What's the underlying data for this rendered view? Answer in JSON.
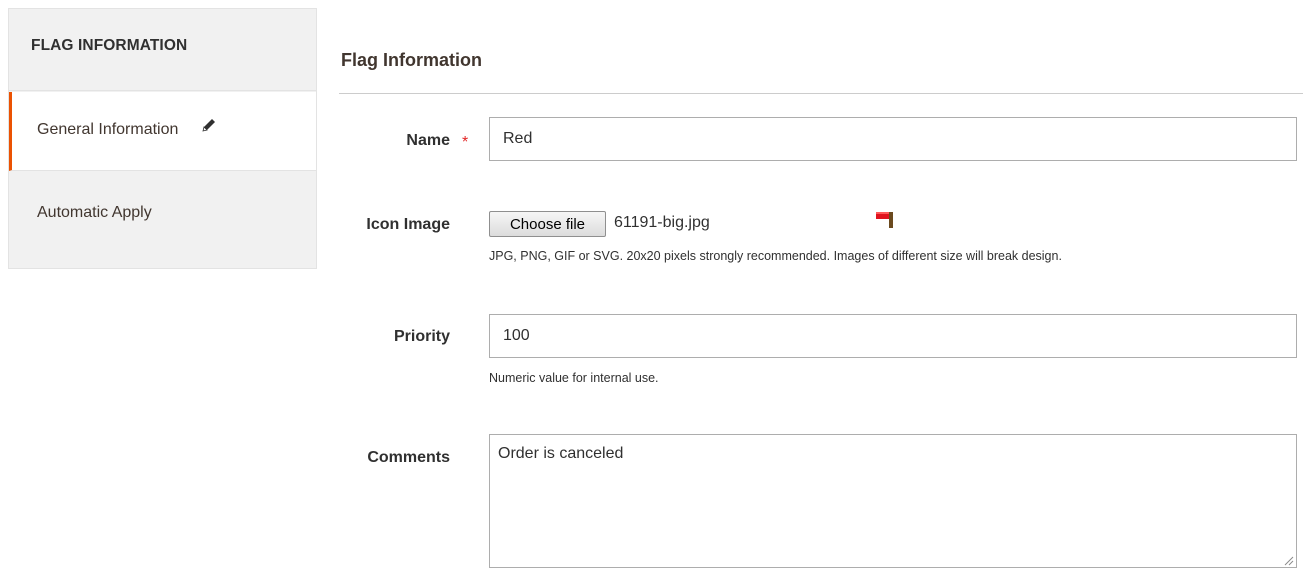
{
  "sidebar": {
    "title": "FLAG INFORMATION",
    "items": [
      {
        "label": "General Information",
        "active": true,
        "icon": "pencil-icon"
      },
      {
        "label": "Automatic Apply",
        "active": false
      }
    ]
  },
  "section": {
    "title": "Flag Information"
  },
  "form": {
    "name": {
      "label": "Name",
      "required_mark": "*",
      "value": "Red"
    },
    "icon_image": {
      "label": "Icon Image",
      "button_label": "Choose file",
      "file_name": "61191-big.jpg",
      "preview_icon": "red-flag-icon",
      "note": "JPG, PNG, GIF or SVG. 20x20 pixels strongly recommended. Images of different size will break design."
    },
    "priority": {
      "label": "Priority",
      "value": "100",
      "note": "Numeric value for internal use."
    },
    "comments": {
      "label": "Comments",
      "value": "Order is canceled"
    }
  },
  "colors": {
    "accent": "#eb5202",
    "required": "#e22626",
    "flag_red": "#e0141e",
    "flag_pole": "#6b4a1f"
  }
}
